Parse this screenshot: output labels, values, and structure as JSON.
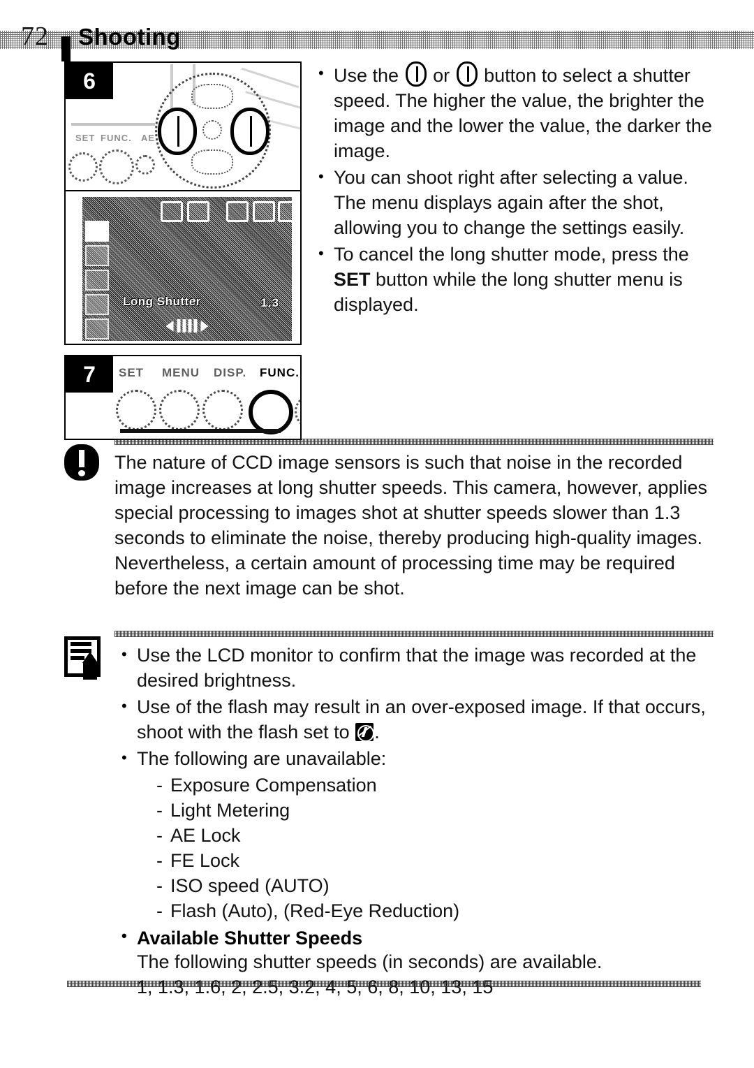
{
  "header": {
    "page_number": "72",
    "title": "Shooting"
  },
  "figures": {
    "step6": {
      "step_label": "6",
      "dial_labels": [
        "SET",
        "FUNC.",
        "AE"
      ],
      "lcd": {
        "setting_label": "Long Shutter",
        "setting_value": "1.3"
      }
    },
    "step7": {
      "step_label": "7",
      "button_labels": [
        "SET",
        "MENU",
        "DISP.",
        "FUNC."
      ]
    }
  },
  "main_bullets": [
    {
      "pre": "Use the",
      "mid": "or",
      "post": "button to select a shutter speed. The higher the value, the brighter the image and the lower the value, the darker the image."
    },
    {
      "text": "You can shoot right after selecting a value. The menu displays again after the shot, allowing you to change the settings easily."
    },
    {
      "pre": "To cancel the long shutter mode, press the",
      "bold": "SET",
      "post": "button while the long shutter menu is displayed."
    }
  ],
  "warning": {
    "text": "The nature of CCD image sensors is such that noise in the recorded image increases at long shutter speeds. This camera, however, applies special processing to images shot at shutter speeds slower than 1.3 seconds to eliminate the noise, thereby producing high-quality images. Nevertheless, a certain amount of processing time may be required before the next image can be shot."
  },
  "note": {
    "bullets": [
      {
        "text": "Use the LCD monitor to confirm that the image was recorded at the desired brightness."
      },
      {
        "pre": "Use of the flash may result in an over-exposed image. If that occurs, shoot with the flash set to",
        "post": "."
      },
      {
        "text": "The following are unavailable:"
      }
    ],
    "unavailable_items": [
      "Exposure Compensation",
      "Light Metering",
      "AE Lock",
      "FE Lock",
      "ISO speed (AUTO)",
      "Flash (Auto), (Red-Eye Reduction)"
    ],
    "shutter_speeds": {
      "heading": "Available Shutter Speeds",
      "intro": "The following shutter speeds (in seconds) are available.",
      "values": "1, 1.3, 1.6, 2, 2.5, 3.2, 4, 5, 6, 8, 10, 13, 15"
    }
  }
}
